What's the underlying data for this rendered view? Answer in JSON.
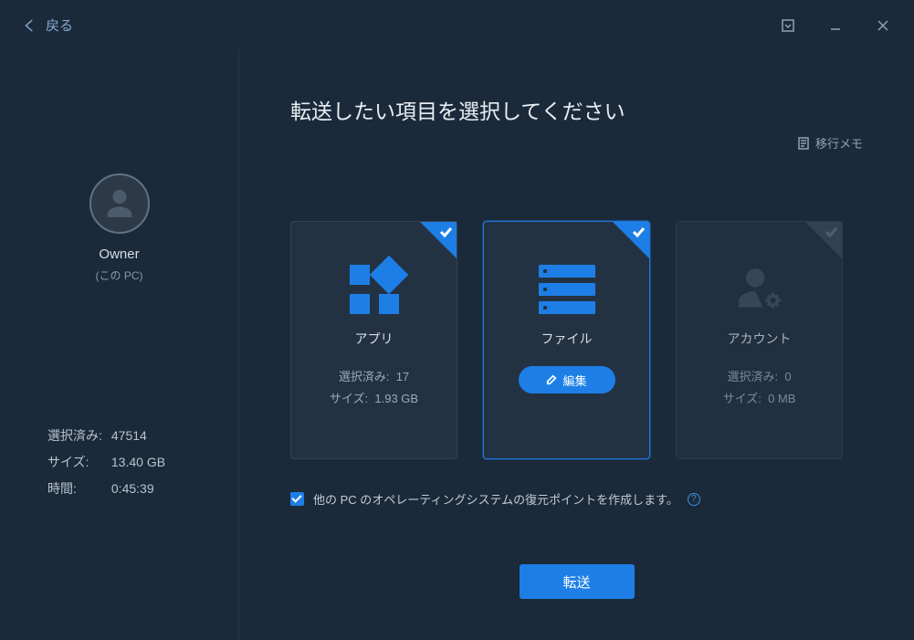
{
  "titlebar": {
    "back_label": "戻る"
  },
  "sidebar": {
    "owner_name": "Owner",
    "owner_sub": "(この PC)",
    "stats": {
      "selected_label": "選択済み:",
      "selected_value": "47514",
      "size_label": "サイズ:",
      "size_value": "13.40 GB",
      "time_label": "時間:",
      "time_value": "0:45:39"
    }
  },
  "main": {
    "title": "転送したい項目を選択してください",
    "memo_label": "移行メモ",
    "cards": {
      "app": {
        "title": "アプリ",
        "selected_label": "選択済み:",
        "selected_value": "17",
        "size_label": "サイズ:",
        "size_value": "1.93 GB"
      },
      "file": {
        "title": "ファイル",
        "edit_label": "編集"
      },
      "account": {
        "title": "アカウント",
        "selected_label": "選択済み:",
        "selected_value": "0",
        "size_label": "サイズ:",
        "size_value": "0 MB"
      }
    },
    "restore_checkbox_label": "他の PC のオペレーティングシステムの復元ポイントを作成します。",
    "help_glyph": "?",
    "transfer_button": "転送"
  }
}
